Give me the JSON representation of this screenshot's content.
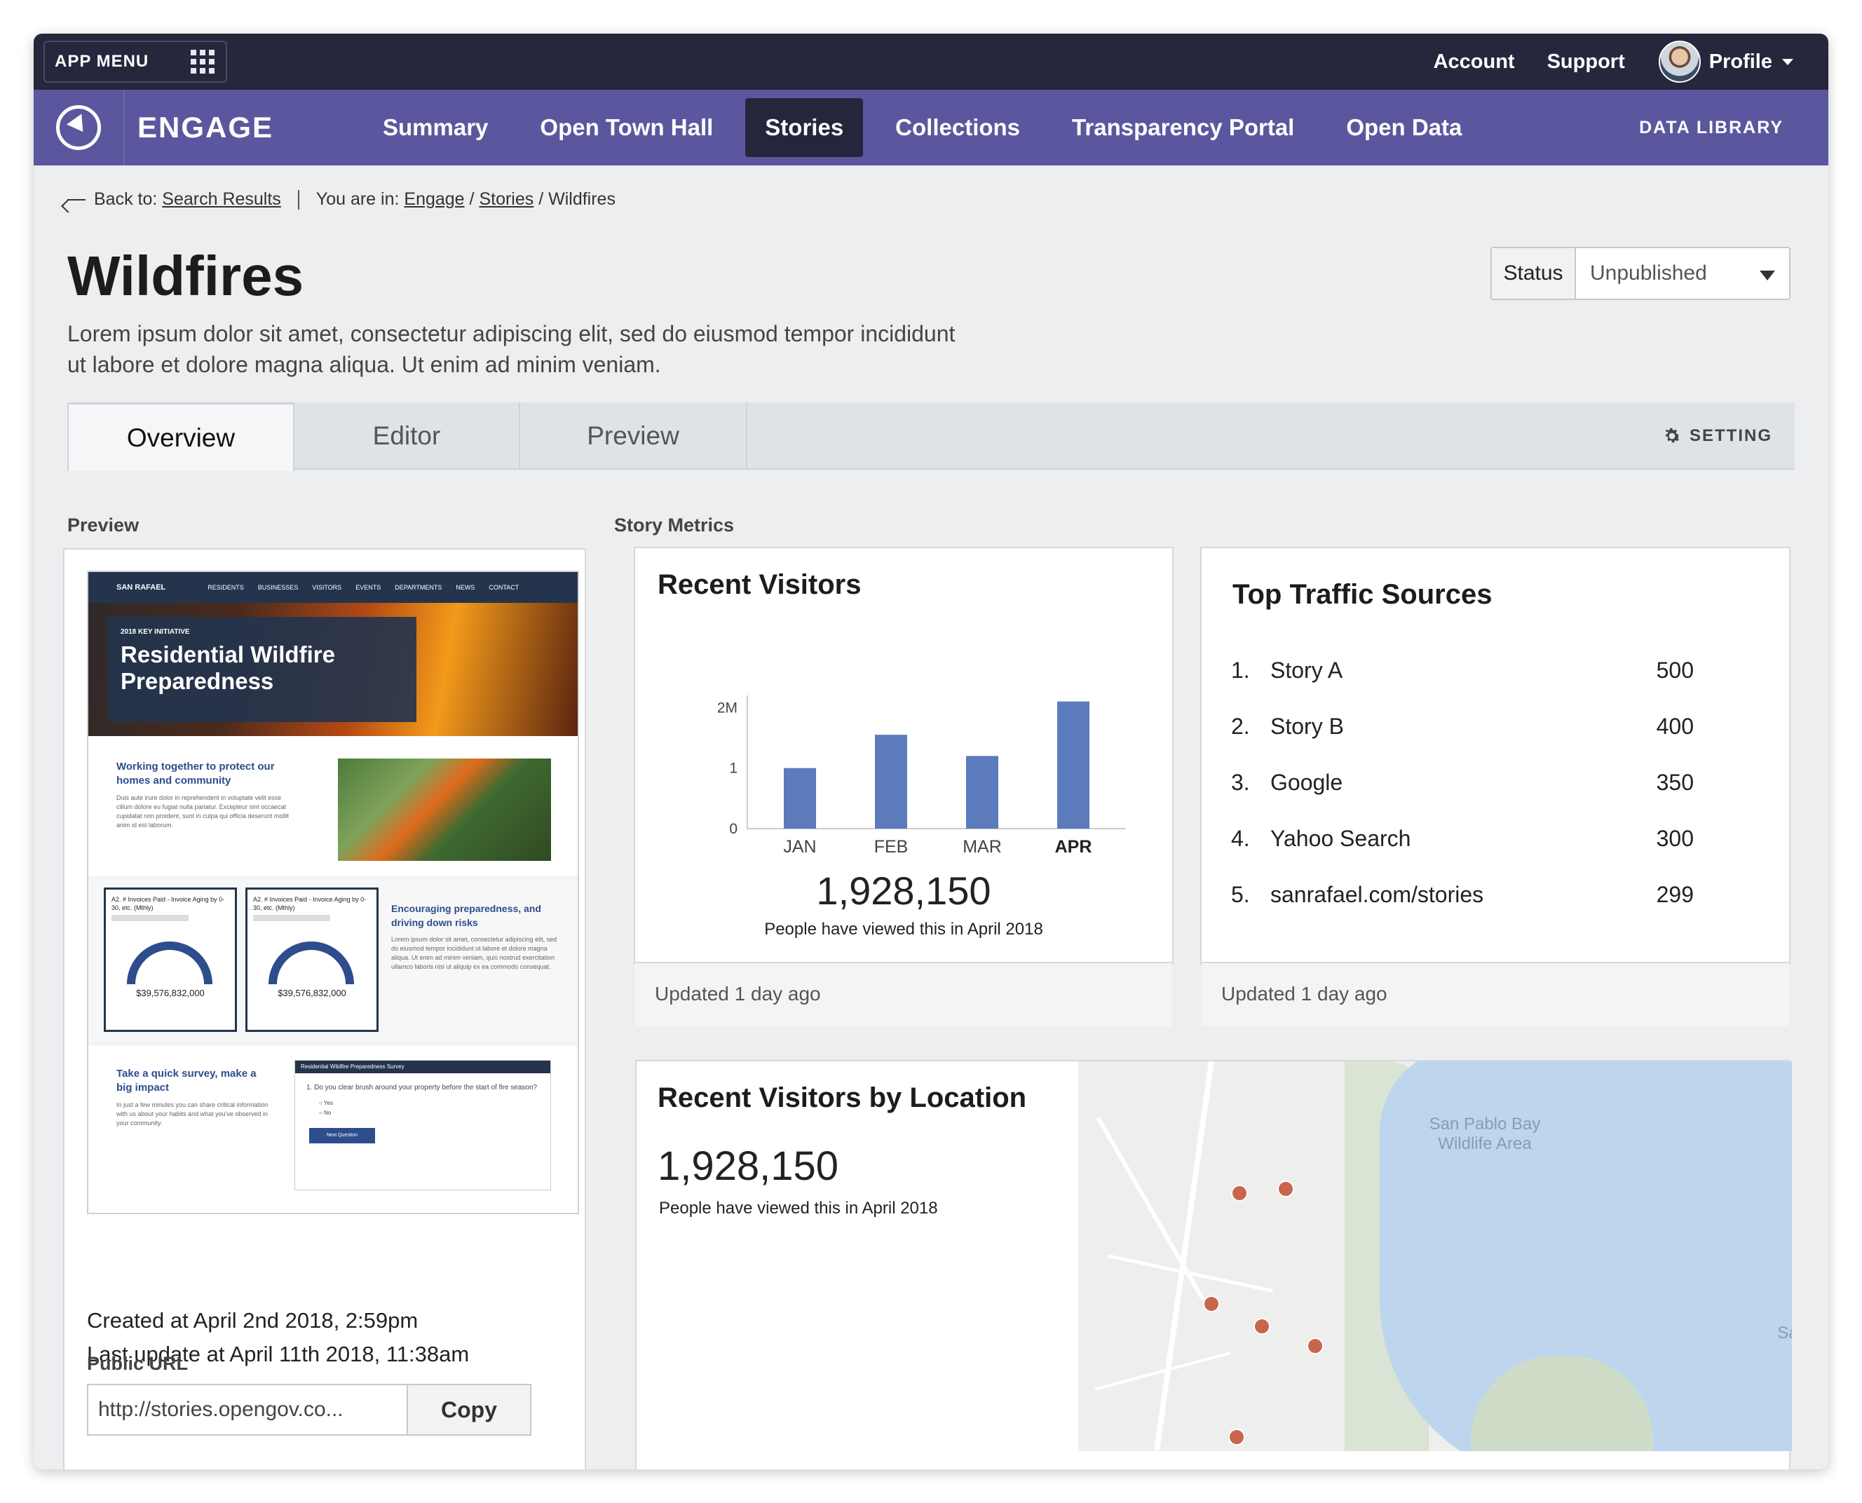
{
  "topbar": {
    "app_menu": "APP MENU",
    "account": "Account",
    "support": "Support",
    "profile": "Profile"
  },
  "nav": {
    "brand": "ENGAGE",
    "items": [
      "Summary",
      "Open Town Hall",
      "Stories",
      "Collections",
      "Transparency Portal",
      "Open Data"
    ],
    "active": "Stories",
    "data_library": "DATA LIBRARY"
  },
  "breadcrumb": {
    "back_prefix": "Back to:",
    "back_link": "Search Results",
    "you_are_in": "You are in:",
    "crumb1": "Engage",
    "slash": "/",
    "crumb2": "Stories",
    "current": "Wildfires"
  },
  "page": {
    "title": "Wildfires",
    "description": "Lorem ipsum dolor sit amet, consectetur adipiscing elit, sed do eiusmod tempor incididunt ut labore et dolore magna aliqua. Ut enim ad minim veniam."
  },
  "status": {
    "label": "Status",
    "value": "Unpublished"
  },
  "tabs": {
    "overview": "Overview",
    "editor": "Editor",
    "preview": "Preview",
    "setting": "SETTING"
  },
  "sections": {
    "preview": "Preview",
    "metrics": "Story Metrics"
  },
  "preview_card": {
    "mini": {
      "logo": "SAN RAFAEL",
      "nav": [
        "RESIDENTS",
        "BUSINESSES",
        "VISITORS",
        "EVENTS",
        "DEPARTMENTS",
        "NEWS",
        "CONTACT"
      ],
      "kicker": "2018 KEY INITIATIVE",
      "hero_title": "Residential Wildfire Preparedness",
      "s1_title": "Working together to protect our homes and community",
      "s1_text": "Duis aute irure dolor in reprehenderit in voluptate velit esse cillum dolore eu fugiat nulla pariatur. Excepteur sint occaecat cupidatat non proident, sunt in culpa qui officia deserunt mollit anim id est laborum.",
      "card_title": "A2. # Invoices Paid - Invoice Aging by 0-30, etc. (Mthly)",
      "card_value": "$39,576,832,000",
      "s2_title": "Encouraging preparedness, and driving down risks",
      "s2_text": "Lorem ipsum dolor sit amet, consectetur adipiscing elit, sed do eiusmod tempor incididunt ut labore et dolore magna aliqua. Ut enim ad minim veniam, quis nostrud exercitation ullamco laboris nisi ut aliquip ex ea commodo consequat.",
      "s3_title": "Take a quick survey, make a big impact",
      "s3_text": "In just a few minutes you can share critical information with us about your habits and what you've observed in your community.",
      "survey_title": "Residential Wildfire Preparedness Survey",
      "survey_q": "1.  Do you clear brush around your property before the start of fire season?",
      "opt_yes": "Yes",
      "opt_no": "No",
      "survey_btn": "Next Question"
    },
    "created": "Created at April 2nd 2018, 2:59pm",
    "updated": "Last update at April 11th 2018, 11:38am",
    "public_url_label": "Public URL",
    "public_url": "http://stories.opengov.co...",
    "copy": "Copy"
  },
  "recent_visitors": {
    "title": "Recent Visitors",
    "total": "1,928,150",
    "caption": "People have viewed this in April 2018",
    "updated": "Updated 1 day ago"
  },
  "chart_data": {
    "type": "bar",
    "categories": [
      "JAN",
      "FEB",
      "MAR",
      "APR"
    ],
    "values": [
      1.0,
      1.55,
      1.2,
      2.1
    ],
    "yticks": [
      "0",
      "1",
      "2M"
    ],
    "ylim": [
      0,
      2.2
    ],
    "highlight": "APR",
    "bar_color": "#5b7bbd"
  },
  "traffic": {
    "title": "Top Traffic Sources",
    "rows": [
      {
        "n": "1.",
        "name": "Story A",
        "value": "500"
      },
      {
        "n": "2.",
        "name": "Story B",
        "value": "400"
      },
      {
        "n": "3.",
        "name": "Google",
        "value": "350"
      },
      {
        "n": "4.",
        "name": "Yahoo Search",
        "value": "300"
      },
      {
        "n": "5.",
        "name": "sanrafael.com/stories",
        "value": "299"
      }
    ],
    "updated": "Updated 1 day ago"
  },
  "location": {
    "title": "Recent Visitors by Location",
    "total": "1,928,150",
    "caption": "People have viewed this in April 2018",
    "map_label": "San Pablo Bay Wildlife Area",
    "map_edge": "Sa"
  }
}
